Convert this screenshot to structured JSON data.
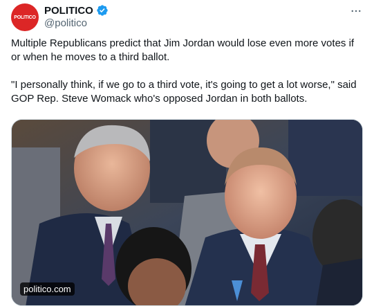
{
  "author": {
    "avatar_text": "POLITICO",
    "display_name": "POLITICO",
    "handle": "@politico",
    "verified": true
  },
  "menu": {
    "icon": "more-horizontal-icon"
  },
  "tweet": {
    "paragraphs": [
      "Multiple Republicans predict that Jim Jordan would lose even more votes if or when he moves to a third ballot.",
      "\"I personally think, if we go to a third vote, it's going to get a lot worse,\" said GOP Rep. Steve Womack who's opposed Jordan in both ballots."
    ]
  },
  "media": {
    "domain": "politico.com"
  },
  "colors": {
    "brand": "#dc2626",
    "verified": "#1d9bf0",
    "secondary_text": "#536471"
  }
}
